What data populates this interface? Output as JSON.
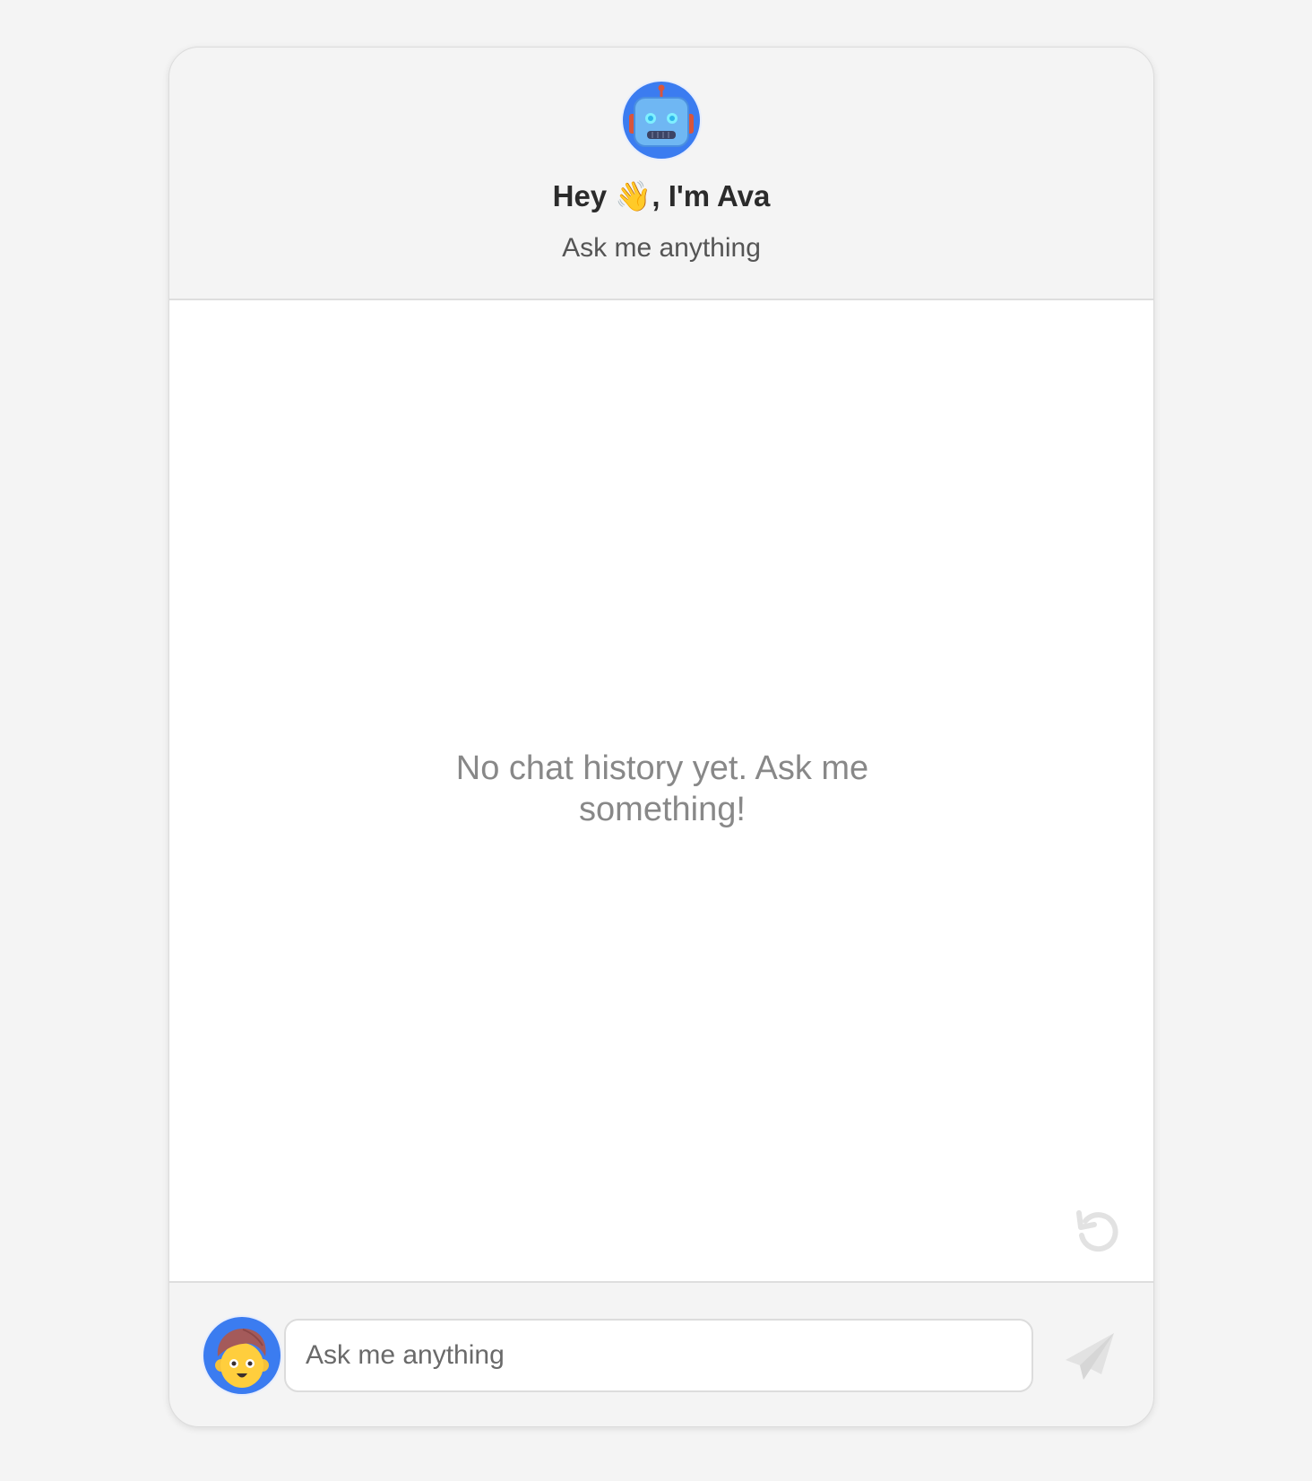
{
  "header": {
    "avatar_icon": "robot-face-icon",
    "title": "Hey 👋, I'm Ava",
    "subtitle": "Ask me anything"
  },
  "messages": {
    "empty_text": "No chat history yet. Ask me something!",
    "reset_icon": "refresh-icon"
  },
  "composer": {
    "avatar_icon": "boy-face-icon",
    "input_value": "",
    "input_placeholder": "Ask me anything",
    "send_icon": "paper-plane-icon"
  },
  "colors": {
    "page_background": "#f4f4f4",
    "avatar_background": "#3b7cf0",
    "title_text": "#2b2b2b",
    "muted_text": "#888888",
    "icon_muted": "#e2e2e2"
  }
}
